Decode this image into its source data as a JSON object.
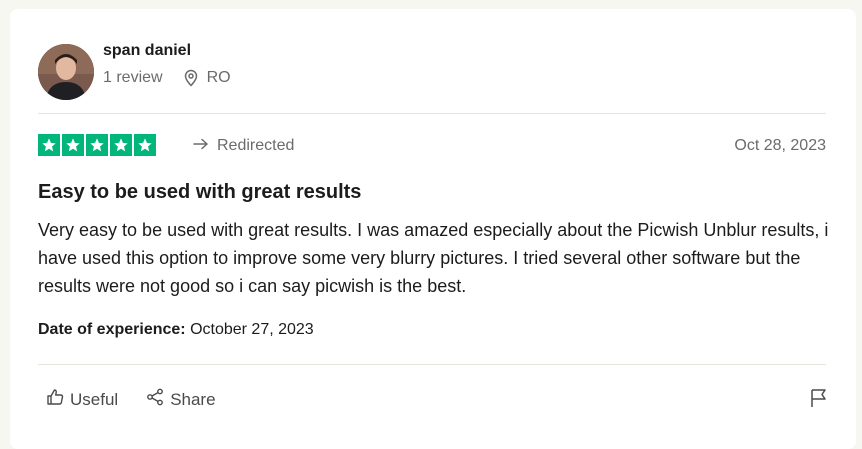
{
  "reviewer": {
    "name": "span daniel",
    "review_count": "1 review",
    "country": "RO"
  },
  "review": {
    "rating": 5,
    "source_label": "Redirected",
    "date": "Oct 28, 2023",
    "title": "Easy to be used with great results",
    "body": "Very easy to be used with great results. I was amazed especially about the Picwish Unblur results, i have used this option to improve some very blurry pictures. I tried several other software but the results were not good so i can say picwish is the best.",
    "experience_label": "Date of experience:",
    "experience_date": "October 27, 2023"
  },
  "actions": {
    "useful": "Useful",
    "share": "Share"
  },
  "colors": {
    "star_green": "#00b67a",
    "muted": "#6b6b6b",
    "divider": "#e5e5dd"
  },
  "icons": [
    "location-pin-icon",
    "redirect-arrow-icon",
    "thumbs-up-icon",
    "share-icon",
    "flag-icon"
  ]
}
